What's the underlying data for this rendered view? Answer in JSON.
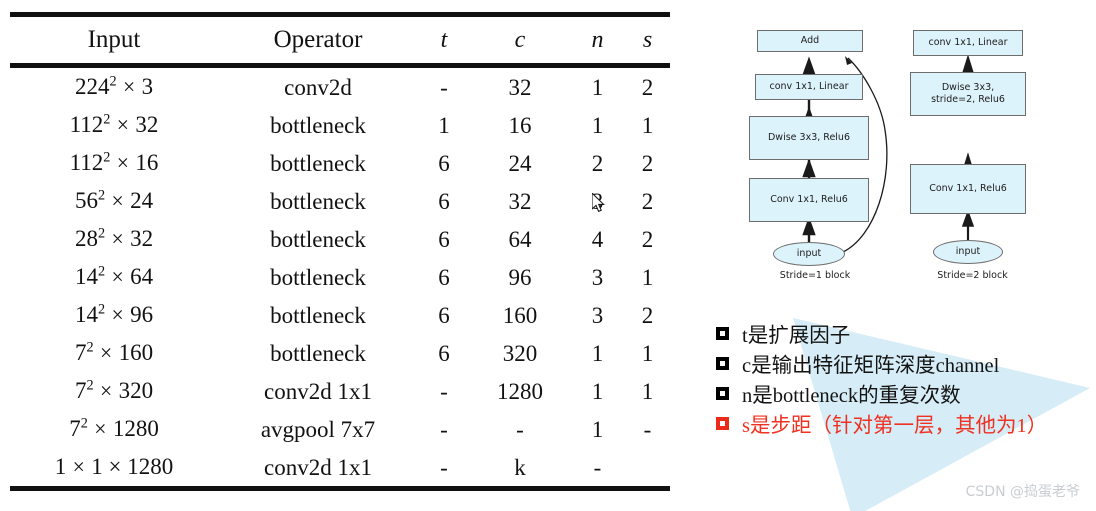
{
  "table": {
    "headers": [
      "Input",
      "Operator",
      "t",
      "c",
      "n",
      "s"
    ],
    "rows": [
      {
        "input_base": "224",
        "input_exp": "2",
        "input_rest": "3",
        "operator": "conv2d",
        "t": "-",
        "c": "32",
        "n": "1",
        "s": "2"
      },
      {
        "input_base": "112",
        "input_exp": "2",
        "input_rest": "32",
        "operator": "bottleneck",
        "t": "1",
        "c": "16",
        "n": "1",
        "s": "1"
      },
      {
        "input_base": "112",
        "input_exp": "2",
        "input_rest": "16",
        "operator": "bottleneck",
        "t": "6",
        "c": "24",
        "n": "2",
        "s": "2"
      },
      {
        "input_base": "56",
        "input_exp": "2",
        "input_rest": "24",
        "operator": "bottleneck",
        "t": "6",
        "c": "32",
        "n": "3",
        "s": "2"
      },
      {
        "input_base": "28",
        "input_exp": "2",
        "input_rest": "32",
        "operator": "bottleneck",
        "t": "6",
        "c": "64",
        "n": "4",
        "s": "2"
      },
      {
        "input_base": "14",
        "input_exp": "2",
        "input_rest": "64",
        "operator": "bottleneck",
        "t": "6",
        "c": "96",
        "n": "3",
        "s": "1"
      },
      {
        "input_base": "14",
        "input_exp": "2",
        "input_rest": "96",
        "operator": "bottleneck",
        "t": "6",
        "c": "160",
        "n": "3",
        "s": "2"
      },
      {
        "input_base": "7",
        "input_exp": "2",
        "input_rest": "160",
        "operator": "bottleneck",
        "t": "6",
        "c": "320",
        "n": "1",
        "s": "1"
      },
      {
        "input_base": "7",
        "input_exp": "2",
        "input_rest": "320",
        "operator": "conv2d 1x1",
        "t": "-",
        "c": "1280",
        "n": "1",
        "s": "1"
      },
      {
        "input_base": "7",
        "input_exp": "2",
        "input_rest": "1280",
        "operator": "avgpool 7x7",
        "t": "-",
        "c": "-",
        "n": "1",
        "s": "-"
      },
      {
        "input_base": "1",
        "input_exp": "",
        "input_rest": "1 × 1280",
        "operator": "conv2d 1x1",
        "t": "-",
        "c": "k",
        "n": "-",
        "s": ""
      }
    ]
  },
  "diagram_stride1": {
    "caption": "Stride=1 block",
    "nodes": [
      {
        "label": "Add"
      },
      {
        "label": "conv 1x1, Linear"
      },
      {
        "label": "Dwise 3x3, Relu6"
      },
      {
        "label": "Conv 1x1, Relu6"
      },
      {
        "label": "input"
      }
    ]
  },
  "diagram_stride2": {
    "caption": "Stride=2 block",
    "nodes": [
      {
        "label": "conv 1x1, Linear"
      },
      {
        "label": "Dwise 3x3,\nstride=2, Relu6"
      },
      {
        "label": "Conv 1x1, Relu6"
      },
      {
        "label": "input"
      }
    ]
  },
  "notes": [
    {
      "text": "t是扩展因子",
      "color": "#131313"
    },
    {
      "text": "c是输出特征矩阵深度channel",
      "color": "#131313"
    },
    {
      "text": "n是bottleneck的重复次数",
      "color": "#131313"
    },
    {
      "text": "s是步距（针对第一层，其他为1）",
      "color": "#f03020"
    }
  ],
  "watermark": "CSDN @捣蛋老爷",
  "colors": {
    "node_fill": "#ddf3fb",
    "node_border": "#6d6d6d",
    "triangle": "#cfe9f5",
    "accent_red": "#f03020",
    "rule": "#111111"
  }
}
